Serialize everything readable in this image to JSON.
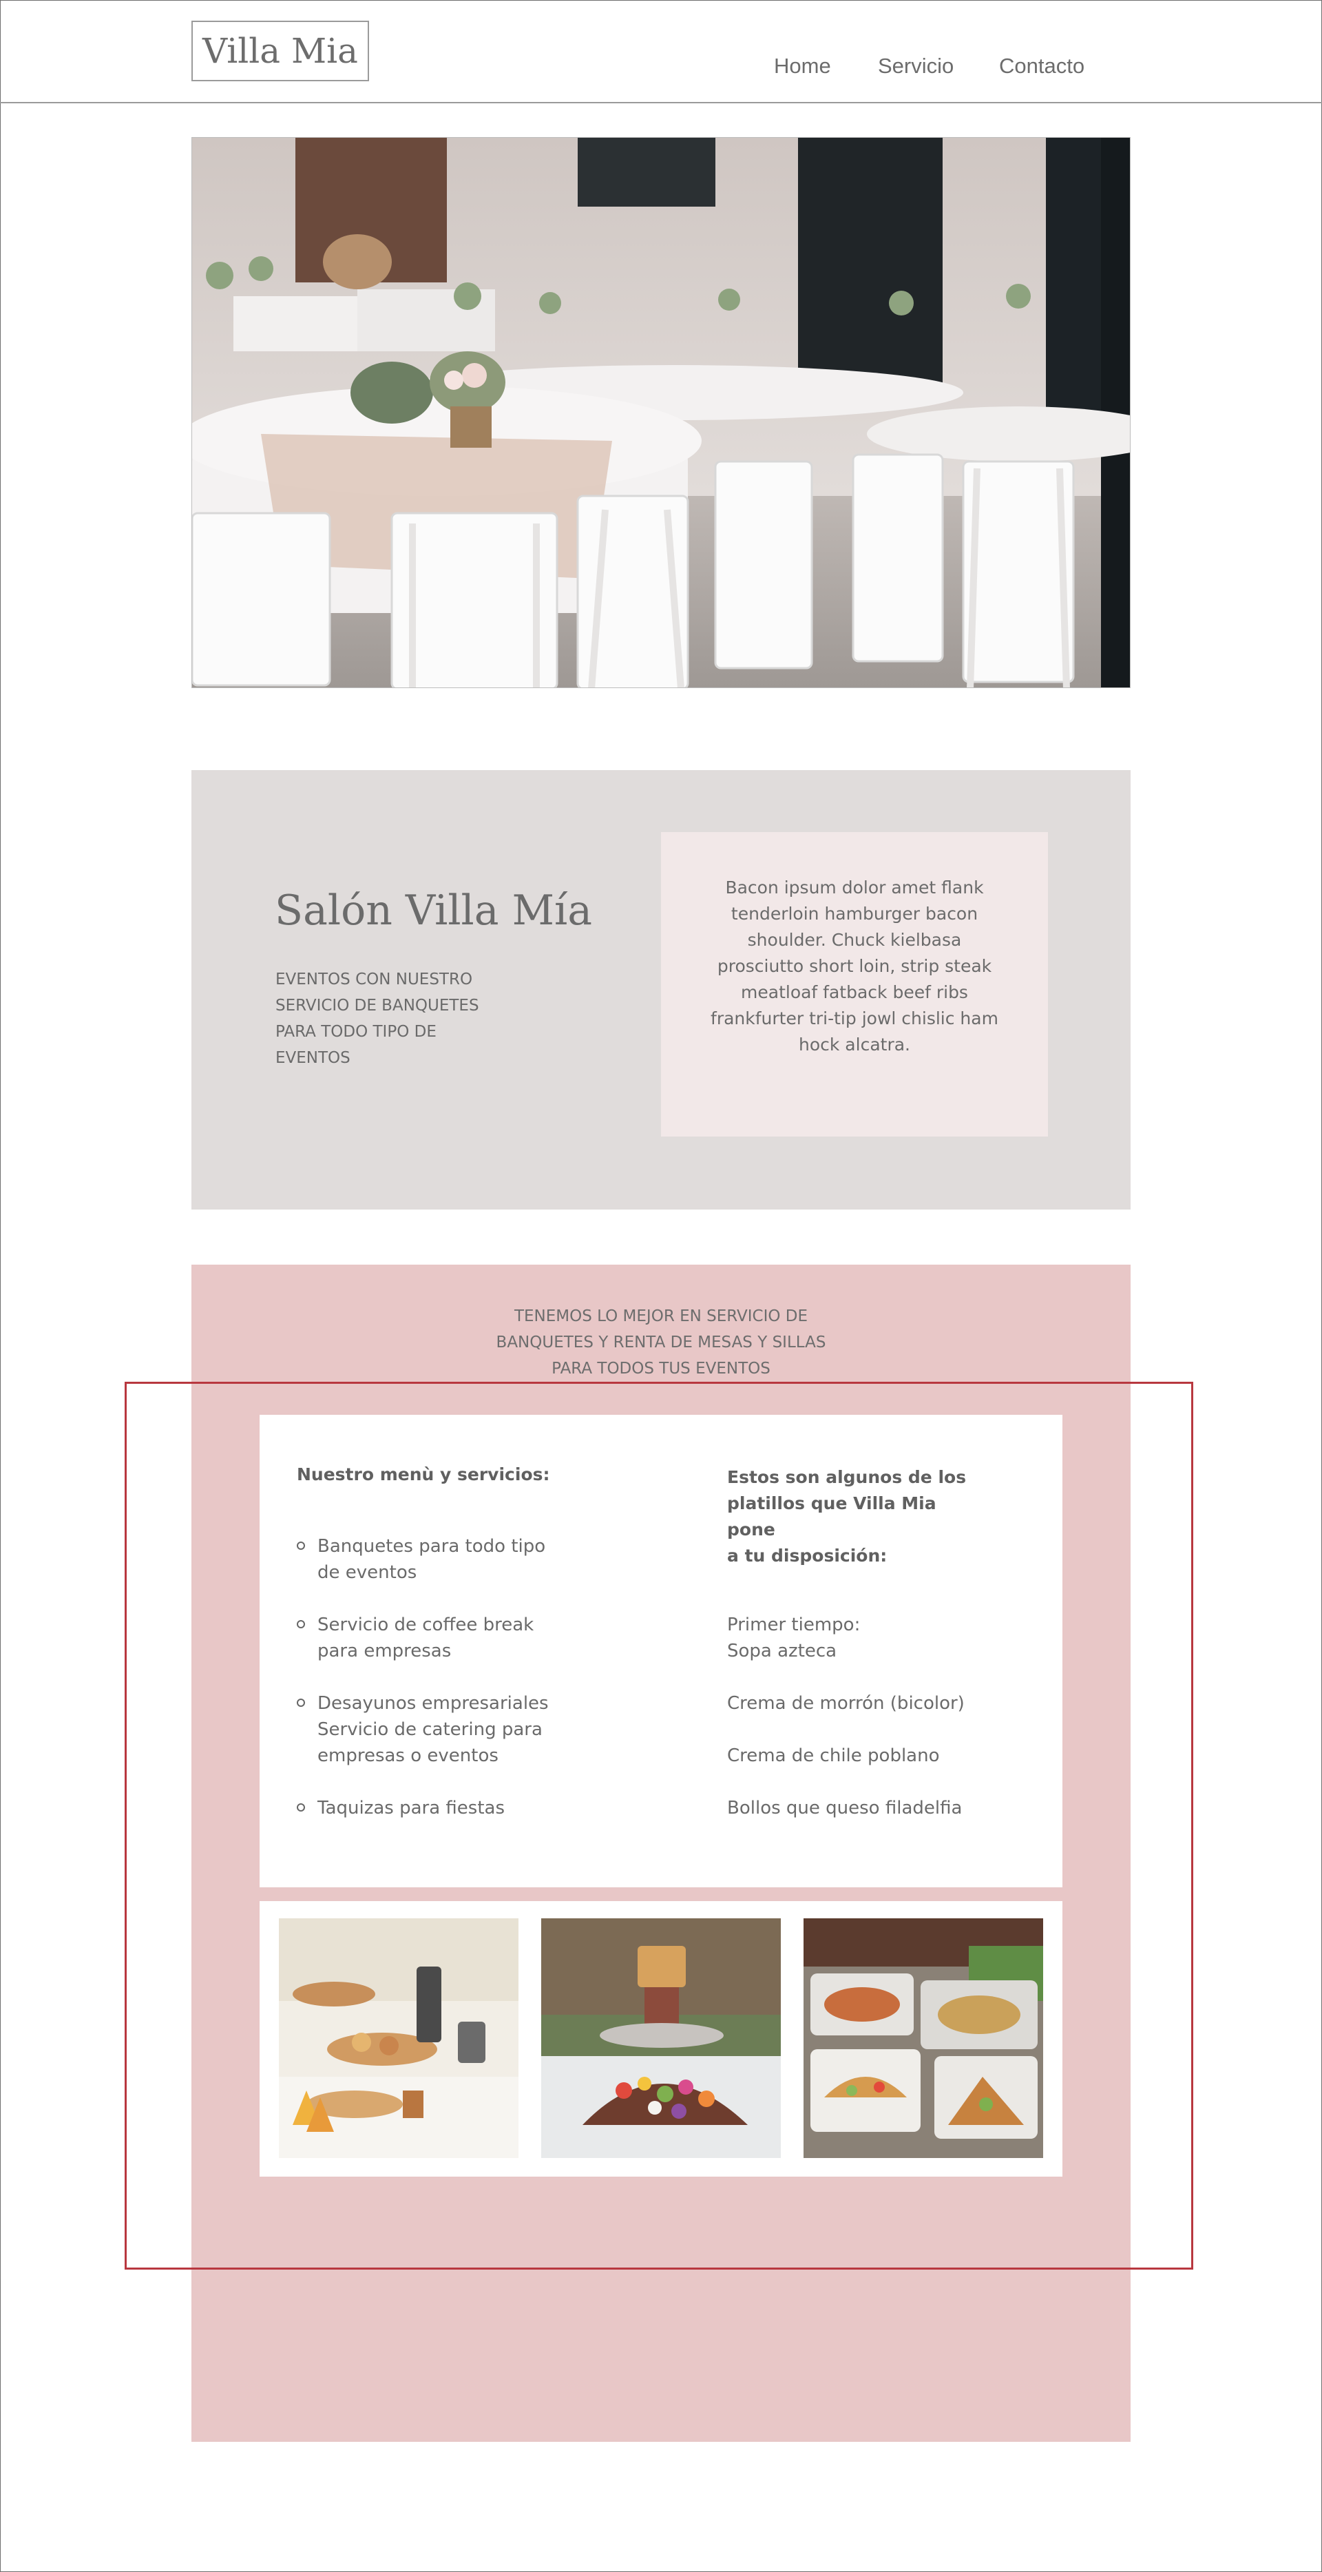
{
  "header": {
    "logo": "Villa Mia",
    "nav": [
      "Home",
      "Servicio",
      "Contacto"
    ]
  },
  "salon": {
    "title": "Salón Villa Mía",
    "subtitle_lines": [
      "EVENTOS CON NUESTRO",
      "SERVICIO DE BANQUETES",
      "PARA TODO TIPO DE",
      "EVENTOS"
    ],
    "body_lines": [
      "Bacon ipsum dolor amet flank",
      "tenderloin hamburger bacon",
      "shoulder. Chuck kielbasa",
      "prosciutto short loin, strip steak",
      "meatloaf fatback beef ribs",
      "frankfurter tri-tip jowl chislic ham",
      "hock alcatra."
    ]
  },
  "services": {
    "intro_lines": [
      "TENEMOS LO MEJOR EN SERVICIO DE",
      "BANQUETES Y RENTA DE MESAS Y SILLAS",
      "PARA TODOS TUS EVENTOS"
    ],
    "menu_title": "Nuestro menù y servicios:",
    "menu_items": [
      [
        "Banquetes para todo tipo",
        "de eventos"
      ],
      [
        "Servicio de coffee break",
        "para empresas"
      ],
      [
        "Desayunos empresariales",
        "Servicio de catering para",
        "empresas o eventos"
      ],
      [
        "Taquizas para fiestas"
      ]
    ],
    "dishes_title_lines": [
      "Estos son algunos de los",
      "platillos que Villa Mia pone",
      "a tu disposición:"
    ],
    "dishes": [
      [
        "Primer tiempo:",
        "Sopa azteca"
      ],
      [
        "Crema de morrón (bicolor)"
      ],
      [
        "Crema de chile poblano"
      ],
      [
        "Bollos que queso filadelfia"
      ]
    ]
  },
  "colors": {
    "salon_bg": "#e0dcdb",
    "salon_box_bg": "#f2e8e8",
    "services_bg": "#e8c7c7",
    "highlight_border": "#b8383f"
  },
  "icons": [
    "hero-banquet-photo",
    "coffee-break-photo",
    "buffet-photo",
    "taquiza-photo"
  ]
}
